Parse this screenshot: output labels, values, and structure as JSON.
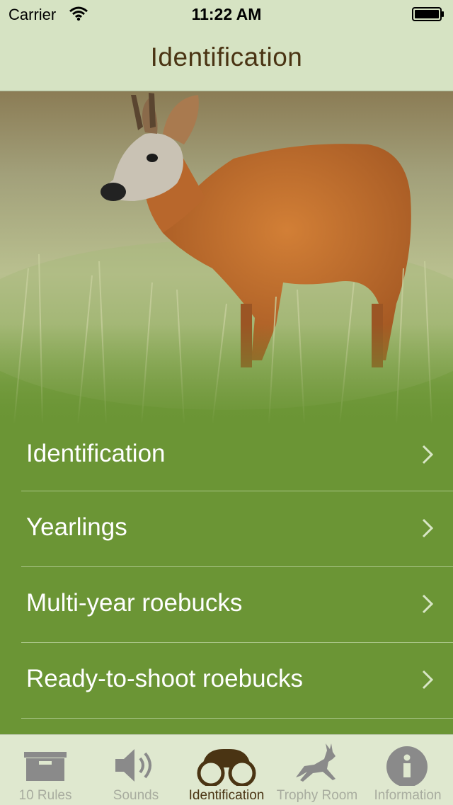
{
  "status_bar": {
    "carrier": "Carrier",
    "time": "11:22 AM"
  },
  "nav": {
    "title": "Identification"
  },
  "hero": {
    "icon": "roe-deer-photo"
  },
  "menu": {
    "items": [
      {
        "label": "Identification"
      },
      {
        "label": "Yearlings"
      },
      {
        "label": "Multi-year roebucks"
      },
      {
        "label": "Ready-to-shoot roebucks"
      }
    ]
  },
  "tabs": [
    {
      "label": "10 Rules",
      "icon": "box-icon",
      "active": false
    },
    {
      "label": "Sounds",
      "icon": "speaker-icon",
      "active": false
    },
    {
      "label": "Identification",
      "icon": "binoculars-icon",
      "active": true
    },
    {
      "label": "Trophy Room",
      "icon": "leaping-deer-icon",
      "active": false
    },
    {
      "label": "Information",
      "icon": "info-icon",
      "active": false
    }
  ],
  "colors": {
    "bar_background": "#d6e3c3",
    "menu_background": "#6b9535",
    "title_brown": "#4a3413",
    "inactive_tab": "#a8ac9f"
  }
}
